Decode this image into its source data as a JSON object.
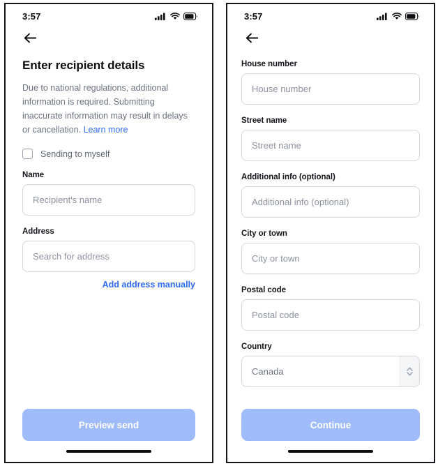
{
  "left_screen": {
    "status_bar": {
      "time": "3:57",
      "signal_icon": "cellular-signal-icon",
      "wifi_icon": "wifi-icon",
      "battery_icon": "battery-icon"
    },
    "back_icon": "back-arrow-icon",
    "title": "Enter recipient details",
    "description_text": "Due to national regulations, additional information is required. Submitting inaccurate information may result in delays or cancellation. ",
    "learn_more_label": "Learn more",
    "checkbox_label": "Sending to myself",
    "checkbox_checked": false,
    "fields": [
      {
        "label": "Name",
        "placeholder": "Recipient's name",
        "value": ""
      },
      {
        "label": "Address",
        "placeholder": "Search for address",
        "value": ""
      }
    ],
    "manual_address_link": "Add address manually",
    "cta_label": "Preview send",
    "cta_color": "#9fbbf9"
  },
  "right_screen": {
    "status_bar": {
      "time": "3:57",
      "signal_icon": "cellular-signal-icon",
      "wifi_icon": "wifi-icon",
      "battery_icon": "battery-icon"
    },
    "back_icon": "back-arrow-icon",
    "fields": [
      {
        "label": "House number",
        "placeholder": "House number",
        "value": ""
      },
      {
        "label": "Street name",
        "placeholder": "Street name",
        "value": ""
      },
      {
        "label": "Additional info (optional)",
        "placeholder": "Additional info (optional)",
        "value": ""
      },
      {
        "label": "City or town",
        "placeholder": "City or town",
        "value": ""
      },
      {
        "label": "Postal code",
        "placeholder": "Postal code",
        "value": ""
      }
    ],
    "country_field": {
      "label": "Country",
      "value": "Canada",
      "stepper_icon": "chevron-up-down-icon"
    },
    "cta_label": "Continue",
    "cta_color": "#9fbbf9"
  },
  "theme": {
    "link_color": "#2f6bf0",
    "text_primary": "#0d0e11",
    "text_secondary": "#6b7280",
    "border_color": "#d4d7de",
    "frame_color": "#16171c"
  }
}
